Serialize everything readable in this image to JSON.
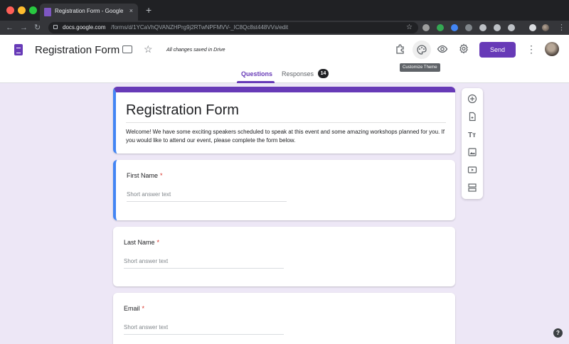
{
  "browser": {
    "tab_title": "Registration Form - Google Forms",
    "tab_close": "×",
    "new_tab": "+",
    "url_host": "docs.google.com",
    "url_path": "/forms/d/1YCaVhQVANZHPrg9j2RTwNPFMVV-_IC8Qc8st448VVs/edit",
    "nav_back": "←",
    "nav_forward": "→",
    "nav_reload": "↻",
    "bookmark_star": "☆"
  },
  "header": {
    "title": "Registration Form",
    "star": "☆",
    "save_status": "All changes saved in Drive",
    "send_label": "Send",
    "more": "⋮",
    "tooltip": "Customize Theme"
  },
  "tabs": {
    "questions": "Questions",
    "responses": "Responses",
    "responses_count": "14"
  },
  "form": {
    "title": "Registration Form",
    "description": "Welcome! We have some exciting speakers scheduled to speak at this event and some amazing workshops planned for you. If you would like to attend our event, please complete the form below.",
    "required_mark": "*",
    "questions": [
      {
        "label": "First Name",
        "placeholder": "Short answer text"
      },
      {
        "label": "Last Name",
        "placeholder": "Short answer text"
      },
      {
        "label": "Email",
        "placeholder": "Short answer text"
      }
    ]
  },
  "help": {
    "label": "?"
  },
  "colors": {
    "accent": "#673ab7",
    "focus": "#4285f4",
    "background": "#ede7f6",
    "required": "#d93025"
  },
  "icons": [
    "add-question-icon",
    "import-questions-icon",
    "add-title-icon",
    "add-image-icon",
    "add-video-icon",
    "add-section-icon"
  ]
}
